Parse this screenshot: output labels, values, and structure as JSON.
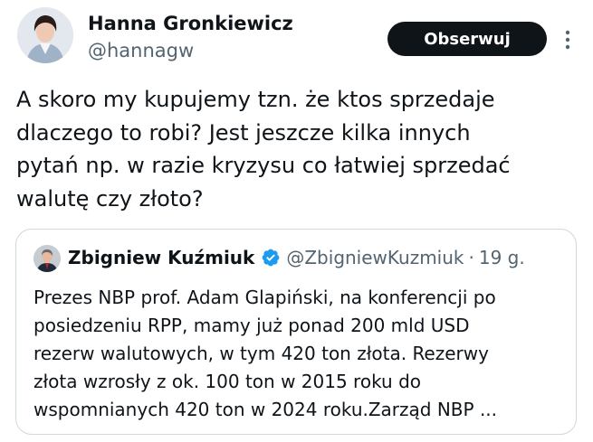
{
  "author": {
    "name": "Hanna Gronkiewicz",
    "handle": "@hannagw",
    "avatar_icon": "profile-photo"
  },
  "actions": {
    "follow_label": "Obserwuj",
    "more_icon": "more-vertical-icon"
  },
  "tweet": {
    "lines": [
      "A skoro my kupujemy tzn. że ktos sprzedaje",
      "dlaczego to robi? Jest jeszcze kilka innych",
      "pytań np. w razie kryzysu co łatwiej sprzedać",
      "walutę czy złoto?"
    ]
  },
  "quote": {
    "name": "Zbigniew Kuźmiuk",
    "verified_icon": "verified-badge-icon",
    "verified_color": "#1d9bf0",
    "handle": "@ZbigniewKuzmiuk",
    "separator": "·",
    "time": "19 g.",
    "lines": [
      "Prezes NBP prof. Adam Glapiński, na konferencji po",
      "posiedzeniu RPP, mamy już ponad 200 mld USD",
      "rezerw walutowych, w tym 420 ton złota. Rezerwy",
      "złota wzrosły z ok. 100 ton w 2015 roku do",
      "wspomnianych 420 ton w 2024 roku.Zarząd NBP ..."
    ]
  },
  "colors": {
    "text": "#0f1419",
    "secondary": "#536471",
    "border": "#cfd9de",
    "button_bg": "#0f1419",
    "button_text": "#ffffff"
  }
}
